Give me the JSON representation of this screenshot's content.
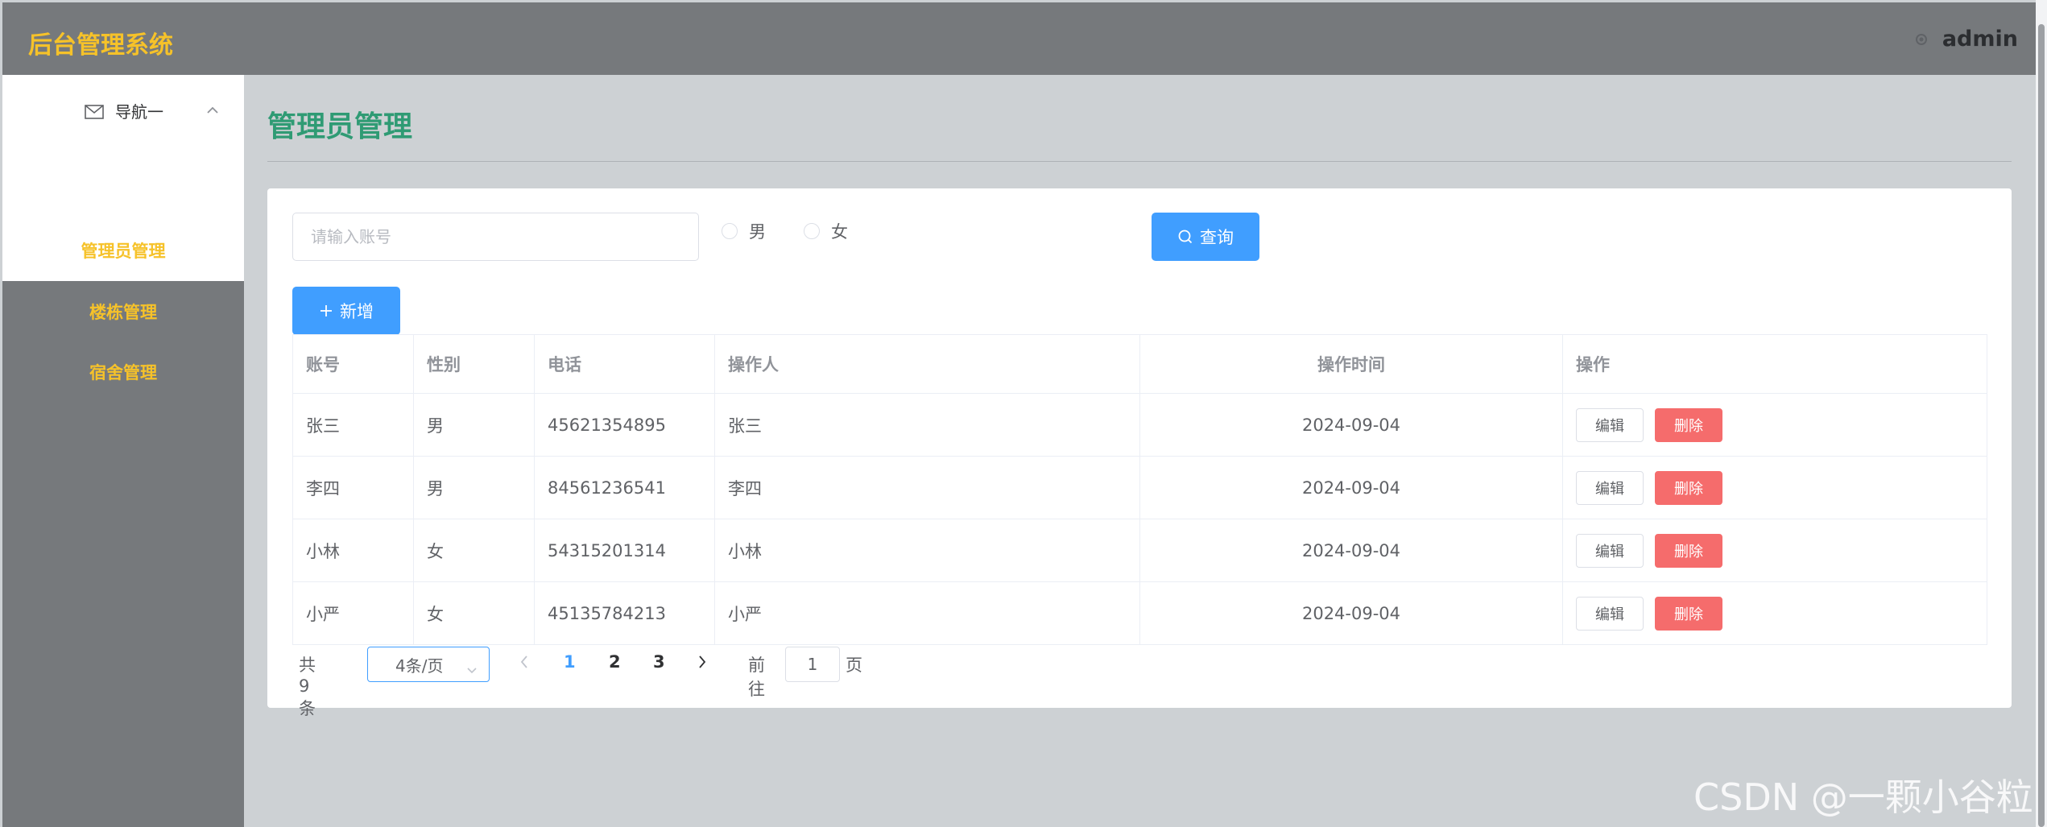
{
  "header": {
    "app_title": "后台管理系统",
    "user_name": "admin",
    "user_icon": "gear-icon"
  },
  "sidebar": {
    "group_label": "导航一",
    "group_icon": "mail-icon",
    "items": [
      {
        "label": "管理员管理",
        "active": true
      },
      {
        "label": "楼栋管理",
        "active": false
      },
      {
        "label": "宿舍管理",
        "active": false
      }
    ]
  },
  "page": {
    "title": "管理员管理"
  },
  "search": {
    "placeholder": "请输入账号",
    "value": "",
    "gender_options": [
      "男",
      "女"
    ],
    "query_label": "查询",
    "add_label": "新增"
  },
  "table": {
    "columns": [
      "账号",
      "性别",
      "电话",
      "操作人",
      "操作时间",
      "操作"
    ],
    "rows": [
      {
        "account": "张三",
        "gender": "男",
        "phone": "45621354895",
        "operator": "张三",
        "time": "2024-09-04"
      },
      {
        "account": "李四",
        "gender": "男",
        "phone": "84561236541",
        "operator": "李四",
        "time": "2024-09-04"
      },
      {
        "account": "小林",
        "gender": "女",
        "phone": "54315201314",
        "operator": "小林",
        "time": "2024-09-04"
      },
      {
        "account": "小严",
        "gender": "女",
        "phone": "45135784213",
        "operator": "小严",
        "time": "2024-09-04"
      }
    ],
    "edit_label": "编辑",
    "delete_label": "删除"
  },
  "pagination": {
    "total_text": "共 9 条",
    "page_size_text": "4条/页",
    "pages": [
      "1",
      "2",
      "3"
    ],
    "current_page": "1",
    "goto_prefix": "前往",
    "goto_value": "1",
    "goto_suffix": "页"
  },
  "watermark": "CSDN @一颗小谷粒",
  "colors": {
    "header_bg": "#76797c",
    "brand_yellow": "#f6c229",
    "title_green": "#2f9b74",
    "primary_blue": "#409eff",
    "danger_red": "#f56c6c",
    "content_bg": "#cdd1d4"
  }
}
